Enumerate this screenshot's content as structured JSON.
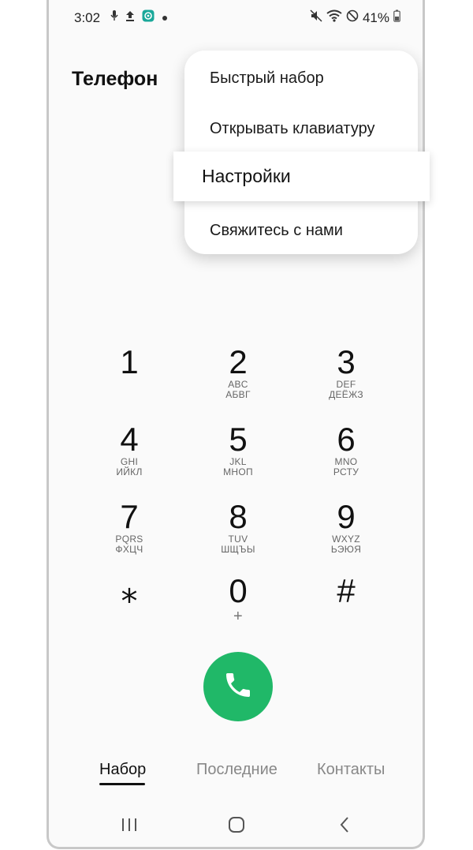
{
  "status_bar": {
    "time": "3:02",
    "battery": "41%",
    "left_icons": [
      "mic-icon",
      "upload-icon",
      "app-notification-icon",
      "dot-icon"
    ],
    "right_icons": [
      "mute-icon",
      "wifi-icon",
      "do-not-disturb-icon",
      "battery-icon"
    ]
  },
  "app": {
    "title": "Телефон"
  },
  "menu": {
    "items": [
      {
        "label": "Быстрый набор"
      },
      {
        "label": "Открывать клавиатуру"
      },
      {
        "label": "Настройки",
        "highlighted": true
      },
      {
        "label": "Свяжитесь с нами"
      }
    ]
  },
  "keypad": {
    "keys": [
      {
        "digit": "1",
        "latin": "",
        "cyrillic": ""
      },
      {
        "digit": "2",
        "latin": "ABC",
        "cyrillic": "АБВГ"
      },
      {
        "digit": "3",
        "latin": "DEF",
        "cyrillic": "ДЕЁЖЗ"
      },
      {
        "digit": "4",
        "latin": "GHI",
        "cyrillic": "ИЙКЛ"
      },
      {
        "digit": "5",
        "latin": "JKL",
        "cyrillic": "МНОП"
      },
      {
        "digit": "6",
        "latin": "MNO",
        "cyrillic": "РСТУ"
      },
      {
        "digit": "7",
        "latin": "PQRS",
        "cyrillic": "ФХЦЧ"
      },
      {
        "digit": "8",
        "latin": "TUV",
        "cyrillic": "ШЩЪЫ"
      },
      {
        "digit": "9",
        "latin": "WXYZ",
        "cyrillic": "ЬЭЮЯ"
      },
      {
        "digit": "⁎",
        "latin": "",
        "cyrillic": ""
      },
      {
        "digit": "0",
        "latin": "+",
        "cyrillic": ""
      },
      {
        "digit": "#",
        "latin": "",
        "cyrillic": ""
      }
    ]
  },
  "call_button": {
    "icon": "phone-icon",
    "color": "#20b868"
  },
  "tabs": [
    {
      "label": "Набор",
      "active": true
    },
    {
      "label": "Последние",
      "active": false
    },
    {
      "label": "Контакты",
      "active": false
    }
  ],
  "nav": [
    "recents-icon",
    "home-icon",
    "back-icon"
  ]
}
